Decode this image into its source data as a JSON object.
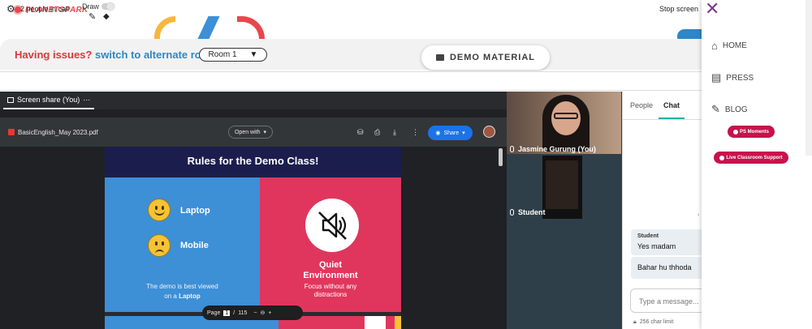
{
  "brand": {
    "logo_text": "PLANETSPARK"
  },
  "draw": {
    "label": "Draw"
  },
  "issues": {
    "prefix": "Having issues?",
    "link": "switch to alternate room"
  },
  "room_select": {
    "value": "Room 1",
    "arrow": "▼"
  },
  "demo_material": {
    "label": "DEMO MATERIAL"
  },
  "call": {
    "people_count": "2 people in call",
    "stop_label": "Stop screen"
  },
  "share": {
    "tab_label": "Screen share (You)",
    "tab_more": "···",
    "pdf_name": "BasicEnglish_May 2023.pdf",
    "open_with": "Open with",
    "share_button": "Share"
  },
  "slide": {
    "title": "Rules for the Demo Class!",
    "laptop": "Laptop",
    "mobile": "Mobile",
    "demo_note_line1": "The demo is best viewed",
    "demo_note_line2_prefix": "on a",
    "demo_note_line2_bold": "Laptop",
    "quiet_line1": "Quiet",
    "quiet_line2": "Environment",
    "quiet_note_line1": "Focus without any",
    "quiet_note_line2": "distractions"
  },
  "pagebar": {
    "page_label": "Page",
    "current_page": "1",
    "separator": "/",
    "total_pages": "115",
    "minus": "−",
    "plus": "+"
  },
  "participants": [
    {
      "name": "Jasmine Gurung (You)"
    },
    {
      "name": "Student"
    }
  ],
  "chat": {
    "tabs": [
      "People",
      "Chat"
    ],
    "active_tab": "Chat",
    "messages": [
      {
        "sender": "Student",
        "text": "Yes madam"
      },
      {
        "sender": "",
        "text": "Bahar hu thhoda"
      }
    ],
    "input_placeholder": "Type a message...",
    "char_limit": "256 char limit"
  },
  "sidebar": {
    "nav": [
      {
        "label": "HOME",
        "icon": "home-icon"
      },
      {
        "label": "PRESS",
        "icon": "newspaper-icon"
      },
      {
        "label": "BLOG",
        "icon": "pencil-icon"
      }
    ],
    "pills": [
      "PS Moments",
      "Live Classroom Support"
    ]
  },
  "colors": {
    "brand_red": "#e8474d",
    "link_blue": "#2f86c8",
    "slide_navy": "#1b1d4d",
    "slide_blue": "#3d8fd6",
    "slide_pink": "#e0365d",
    "pill_red": "#c8124c",
    "chat_accent": "#13b5a3"
  }
}
